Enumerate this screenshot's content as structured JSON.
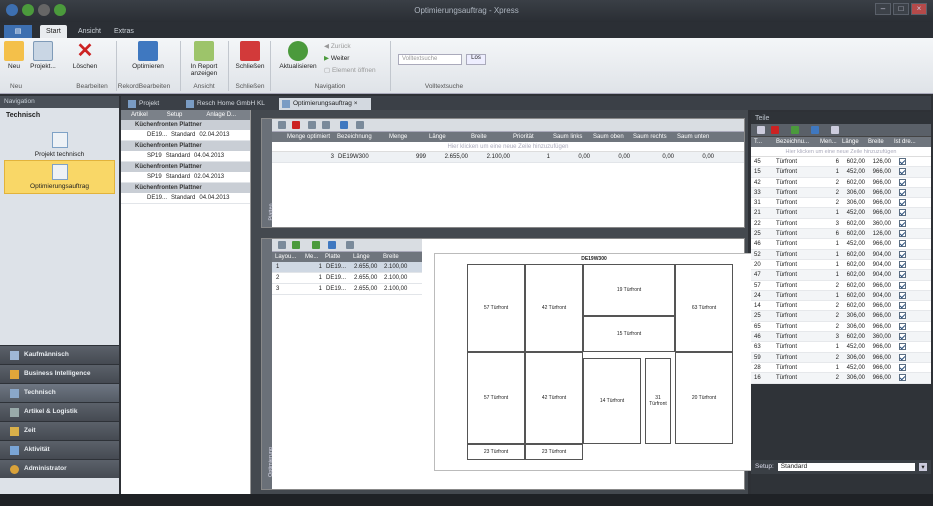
{
  "window": {
    "title": "Optimierungsauftrag - Xpress"
  },
  "menu_tabs": [
    "Start",
    "Ansicht",
    "Extras"
  ],
  "ribbon": {
    "buttons": {
      "neu": "Neu",
      "projekt": "Projekt...",
      "loeschen": "Löschen",
      "optimieren": "Optimieren",
      "report": "In Report anzeigen",
      "schliessen": "Schließen",
      "aktualisieren": "Aktualisieren",
      "zurueck": "Zurück",
      "weiter": "Weiter",
      "element_oeffnen": "Element öffnen",
      "search_value": "Volltextsuche",
      "search_btn": "Los"
    },
    "groups": {
      "neu": "Neu",
      "bearbeiten": "Bearbeiten",
      "rekord": "RekordBearbeiten",
      "ansicht": "Ansicht",
      "schliessen": "Schließen",
      "navigation": "Navigation",
      "volltext": "Volltextsuche"
    }
  },
  "sidebar": {
    "header": "Navigation",
    "section": "Technisch",
    "items": [
      "Projekt technisch",
      "Optimierungsauftrag"
    ],
    "nav": [
      "Kaufmännisch",
      "Business Intelligence",
      "Technisch",
      "Artikel & Logistik",
      "Zeit",
      "Aktivität",
      "Administrator"
    ]
  },
  "doc_tabs": [
    "Projekt",
    "Resch Home GmbH KL",
    "Optimierungsauftrag"
  ],
  "tree": {
    "columns": [
      "Artikel",
      "Setup",
      "Anlage D..."
    ],
    "groups": [
      {
        "title": "Küchenfronten Plattner",
        "row": [
          "DE19...",
          "Standard",
          "02.04.2013"
        ]
      },
      {
        "title": "Küchenfronten Plattner",
        "row": [
          "SP19",
          "Standard",
          "04.04.2013"
        ]
      },
      {
        "title": "Küchenfronten Plattner",
        "row": [
          "SP19",
          "Standard",
          "02.04.2013"
        ]
      },
      {
        "title": "Küchenfronten Plattner",
        "row": [
          "DE19...",
          "Standard",
          "04.04.2013"
        ]
      }
    ]
  },
  "platten": {
    "label": "Platten",
    "columns": [
      "Menge optimiert",
      "Bezeichnung",
      "Menge",
      "Länge",
      "Breite",
      "Priorität",
      "Saum links",
      "Saum oben",
      "Saum rechts",
      "Saum unten"
    ],
    "new_row_hint": "Hier klicken um eine neue Zeile hinzuzufügen",
    "row": [
      "3",
      "DE19W300",
      "999",
      "2.655,00",
      "2.100,00",
      "1",
      "0,00",
      "0,00",
      "0,00",
      "0,00"
    ]
  },
  "layouts": {
    "label": "Optimierung",
    "columns": [
      "Layou...",
      "Me...",
      "Platte",
      "Länge",
      "Breite"
    ],
    "rows": [
      [
        "1",
        "1",
        "DE19...",
        "2.655,00",
        "2.100,00"
      ],
      [
        "2",
        "1",
        "DE19...",
        "2.655,00",
        "2.100,00"
      ],
      [
        "3",
        "1",
        "DE19...",
        "2.655,00",
        "2.100,00"
      ]
    ],
    "plan_title": "DE19W300",
    "pieces": [
      "57 Türfront",
      "42 Türfront",
      "19 Türfront",
      "63 Türfront",
      "15 Türfront",
      "57 Türfront",
      "42 Türfront",
      "14 Türfront",
      "31 Türfront",
      "20 Türfront",
      "23 Türfront",
      "23 Türfront"
    ]
  },
  "teile": {
    "title": "Teile",
    "columns": [
      "T...",
      "Bezeichnu...",
      "Men...",
      "Länge",
      "Breite",
      "Ist dre..."
    ],
    "new_row_hint": "Hier klicken um eine neue Zeile hinzuzufügen",
    "rows": [
      [
        "45",
        "Türfront",
        "6",
        "602,00",
        "126,00"
      ],
      [
        "15",
        "Türfront",
        "1",
        "452,00",
        "966,00"
      ],
      [
        "42",
        "Türfront",
        "2",
        "602,00",
        "966,00"
      ],
      [
        "33",
        "Türfront",
        "2",
        "306,00",
        "966,00"
      ],
      [
        "31",
        "Türfront",
        "2",
        "306,00",
        "966,00"
      ],
      [
        "21",
        "Türfront",
        "1",
        "452,00",
        "966,00"
      ],
      [
        "22",
        "Türfront",
        "3",
        "602,00",
        "360,00"
      ],
      [
        "25",
        "Türfront",
        "6",
        "602,00",
        "126,00"
      ],
      [
        "46",
        "Türfront",
        "1",
        "452,00",
        "966,00"
      ],
      [
        "52",
        "Türfront",
        "1",
        "602,00",
        "904,00"
      ],
      [
        "20",
        "Türfront",
        "1",
        "602,00",
        "904,00"
      ],
      [
        "47",
        "Türfront",
        "1",
        "602,00",
        "904,00"
      ],
      [
        "57",
        "Türfront",
        "2",
        "602,00",
        "966,00"
      ],
      [
        "24",
        "Türfront",
        "1",
        "602,00",
        "904,00"
      ],
      [
        "14",
        "Türfront",
        "2",
        "602,00",
        "966,00"
      ],
      [
        "25",
        "Türfront",
        "2",
        "306,00",
        "966,00"
      ],
      [
        "65",
        "Türfront",
        "2",
        "306,00",
        "966,00"
      ],
      [
        "46",
        "Türfront",
        "3",
        "602,00",
        "360,00"
      ],
      [
        "63",
        "Türfront",
        "1",
        "452,00",
        "966,00"
      ],
      [
        "59",
        "Türfront",
        "2",
        "306,00",
        "966,00"
      ],
      [
        "28",
        "Türfront",
        "1",
        "452,00",
        "966,00"
      ],
      [
        "16",
        "Türfront",
        "2",
        "306,00",
        "966,00"
      ]
    ],
    "setup_label": "Setup:",
    "setup_value": "Standard"
  }
}
